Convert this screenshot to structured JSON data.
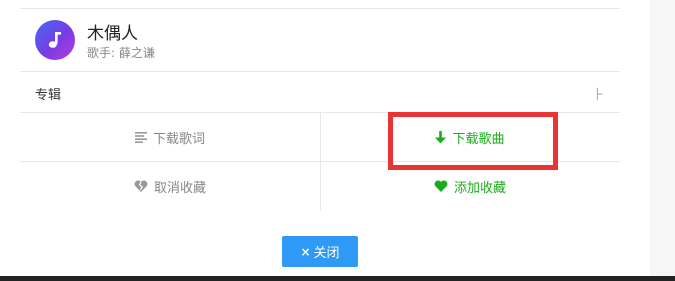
{
  "song": {
    "title": "木偶人",
    "artist_label": "歌手: 薛之谦",
    "cover_icon": "music-note-icon"
  },
  "album": {
    "label": "专辑",
    "icon_glyph": "⺊"
  },
  "actions": {
    "download_lyrics": "下载歌词",
    "download_song": "下载歌曲",
    "unfavorite": "取消收藏",
    "add_favorite": "添加收藏"
  },
  "close_button": {
    "label": "关闭",
    "icon": "×"
  },
  "colors": {
    "accent_green": "#1aad19",
    "button_blue": "#2e9af5",
    "highlight_red": "#ea3333"
  }
}
